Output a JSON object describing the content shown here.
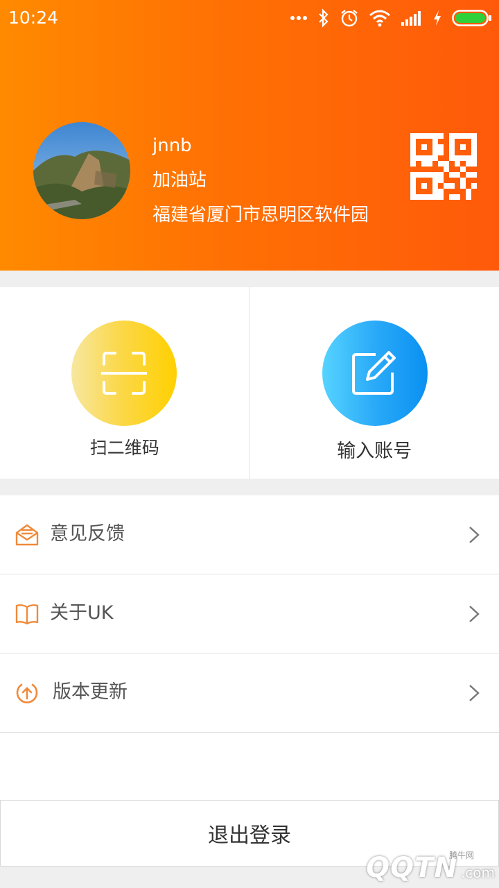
{
  "status_bar": {
    "time": "10:24",
    "icons": [
      "more-dots-icon",
      "bluetooth-icon",
      "alarm-icon",
      "wifi-icon",
      "signal-icon",
      "charging-icon",
      "battery-icon"
    ],
    "battery_level": 1.0
  },
  "profile": {
    "username": "jnnb",
    "station_name": "加油站",
    "address": "福建省厦门市思明区软件园",
    "qr_icon": "qr-code-icon"
  },
  "actions": [
    {
      "label": "扫二维码",
      "icon": "scan-icon"
    },
    {
      "label": "输入账号",
      "icon": "edit-icon"
    }
  ],
  "menu": [
    {
      "label": "意见反馈",
      "icon": "mail-icon"
    },
    {
      "label": "关于UK",
      "icon": "book-icon"
    },
    {
      "label": "版本更新",
      "icon": "update-icon"
    }
  ],
  "logout_label": "退出登录",
  "watermark": {
    "top": "腾牛网",
    "brand": "QQTN",
    "suffix": ".com"
  },
  "colors": {
    "header_start": "#ff8a00",
    "header_end": "#ff5a0a",
    "menu_icon": "#f08a3a",
    "scan_circle": "#ffd000",
    "edit_circle": "#0a90f2"
  }
}
